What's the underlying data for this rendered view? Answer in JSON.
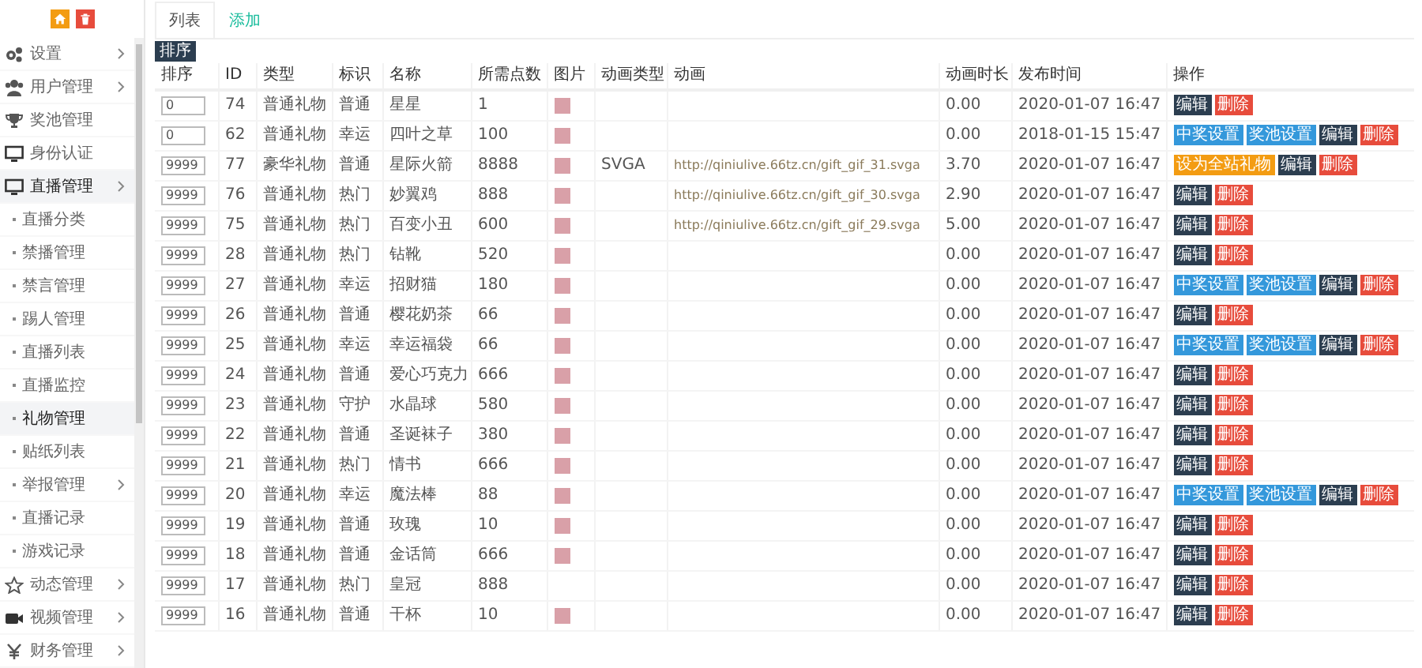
{
  "sidebar": {
    "items": [
      {
        "label": "设置",
        "submenu": true,
        "expanded": false
      },
      {
        "label": "用户管理",
        "submenu": true,
        "expanded": false
      },
      {
        "label": "奖池管理",
        "submenu": false,
        "expanded": false
      },
      {
        "label": "身份认证",
        "submenu": false,
        "expanded": false
      },
      {
        "label": "直播管理",
        "submenu": true,
        "expanded": true,
        "children": [
          {
            "label": "直播分类",
            "selected": false,
            "submenu": false
          },
          {
            "label": "禁播管理",
            "selected": false,
            "submenu": false
          },
          {
            "label": "禁言管理",
            "selected": false,
            "submenu": false
          },
          {
            "label": "踢人管理",
            "selected": false,
            "submenu": false
          },
          {
            "label": "直播列表",
            "selected": false,
            "submenu": false
          },
          {
            "label": "直播监控",
            "selected": false,
            "submenu": false
          },
          {
            "label": "礼物管理",
            "selected": true,
            "submenu": false
          },
          {
            "label": "贴纸列表",
            "selected": false,
            "submenu": false
          },
          {
            "label": "举报管理",
            "selected": false,
            "submenu": true
          },
          {
            "label": "直播记录",
            "selected": false,
            "submenu": false
          },
          {
            "label": "游戏记录",
            "selected": false,
            "submenu": false
          }
        ]
      },
      {
        "label": "动态管理",
        "submenu": true,
        "expanded": false
      },
      {
        "label": "视频管理",
        "submenu": true,
        "expanded": false
      },
      {
        "label": "财务管理",
        "submenu": true,
        "expanded": false
      }
    ]
  },
  "tabs": [
    {
      "label": "列表",
      "selected": true
    },
    {
      "label": "添加",
      "selected": false
    }
  ],
  "sort_button": "排序",
  "table": {
    "columns": [
      "排序",
      "ID",
      "类型",
      "标识",
      "名称",
      "所需点数",
      "图片",
      "动画类型",
      "动画",
      "动画时长",
      "发布时间",
      "操作"
    ],
    "rows": [
      {
        "sort": "0",
        "id": "74",
        "type": "普通礼物",
        "mark": "普通",
        "name": "星星",
        "points": "1",
        "has_image": true,
        "duration": "0.00",
        "time": "2020-01-07 16:47",
        "actions": [
          {
            "label": "编辑",
            "kind": "dark"
          },
          {
            "label": "删除",
            "kind": "red"
          }
        ]
      },
      {
        "sort": "0",
        "id": "62",
        "type": "普通礼物",
        "mark": "幸运",
        "name": "四叶之草",
        "points": "100",
        "has_image": true,
        "duration": "0.00",
        "time": "2018-01-15 15:47",
        "actions": [
          {
            "label": "中奖设置",
            "kind": "blue"
          },
          {
            "label": "奖池设置",
            "kind": "blue"
          },
          {
            "label": "编辑",
            "kind": "dark"
          },
          {
            "label": "删除",
            "kind": "red"
          }
        ]
      },
      {
        "sort": "9999",
        "id": "77",
        "type": "豪华礼物",
        "mark": "普通",
        "name": "星际火箭",
        "points": "8888",
        "has_image": true,
        "anim_type": "SVGA",
        "anim": "http://qiniulive.66tz.cn/gift_gif_31.svga",
        "duration": "3.70",
        "time": "2020-01-07 16:47",
        "actions": [
          {
            "label": "设为全站礼物",
            "kind": "orange"
          },
          {
            "label": "编辑",
            "kind": "dark"
          },
          {
            "label": "删除",
            "kind": "red"
          }
        ]
      },
      {
        "sort": "9999",
        "id": "76",
        "type": "普通礼物",
        "mark": "热门",
        "name": "妙翼鸡",
        "points": "888",
        "has_image": true,
        "anim": "http://qiniulive.66tz.cn/gift_gif_30.svga",
        "duration": "2.90",
        "time": "2020-01-07 16:47",
        "actions": [
          {
            "label": "编辑",
            "kind": "dark"
          },
          {
            "label": "删除",
            "kind": "red"
          }
        ]
      },
      {
        "sort": "9999",
        "id": "75",
        "type": "普通礼物",
        "mark": "热门",
        "name": "百变小丑",
        "points": "600",
        "has_image": true,
        "anim": "http://qiniulive.66tz.cn/gift_gif_29.svga",
        "duration": "5.00",
        "time": "2020-01-07 16:47",
        "actions": [
          {
            "label": "编辑",
            "kind": "dark"
          },
          {
            "label": "删除",
            "kind": "red"
          }
        ]
      },
      {
        "sort": "9999",
        "id": "28",
        "type": "普通礼物",
        "mark": "热门",
        "name": "钻靴",
        "points": "520",
        "has_image": true,
        "duration": "0.00",
        "time": "2020-01-07 16:47",
        "actions": [
          {
            "label": "编辑",
            "kind": "dark"
          },
          {
            "label": "删除",
            "kind": "red"
          }
        ]
      },
      {
        "sort": "9999",
        "id": "27",
        "type": "普通礼物",
        "mark": "幸运",
        "name": "招财猫",
        "points": "180",
        "has_image": true,
        "duration": "0.00",
        "time": "2020-01-07 16:47",
        "actions": [
          {
            "label": "中奖设置",
            "kind": "blue"
          },
          {
            "label": "奖池设置",
            "kind": "blue"
          },
          {
            "label": "编辑",
            "kind": "dark"
          },
          {
            "label": "删除",
            "kind": "red"
          }
        ]
      },
      {
        "sort": "9999",
        "id": "26",
        "type": "普通礼物",
        "mark": "普通",
        "name": "樱花奶茶",
        "points": "66",
        "has_image": true,
        "duration": "0.00",
        "time": "2020-01-07 16:47",
        "actions": [
          {
            "label": "编辑",
            "kind": "dark"
          },
          {
            "label": "删除",
            "kind": "red"
          }
        ]
      },
      {
        "sort": "9999",
        "id": "25",
        "type": "普通礼物",
        "mark": "幸运",
        "name": "幸运福袋",
        "points": "66",
        "has_image": true,
        "duration": "0.00",
        "time": "2020-01-07 16:47",
        "actions": [
          {
            "label": "中奖设置",
            "kind": "blue"
          },
          {
            "label": "奖池设置",
            "kind": "blue"
          },
          {
            "label": "编辑",
            "kind": "dark"
          },
          {
            "label": "删除",
            "kind": "red"
          }
        ]
      },
      {
        "sort": "9999",
        "id": "24",
        "type": "普通礼物",
        "mark": "普通",
        "name": "爱心巧克力",
        "points": "666",
        "has_image": true,
        "duration": "0.00",
        "time": "2020-01-07 16:47",
        "actions": [
          {
            "label": "编辑",
            "kind": "dark"
          },
          {
            "label": "删除",
            "kind": "red"
          }
        ]
      },
      {
        "sort": "9999",
        "id": "23",
        "type": "普通礼物",
        "mark": "守护",
        "name": "水晶球",
        "points": "580",
        "has_image": true,
        "duration": "0.00",
        "time": "2020-01-07 16:47",
        "actions": [
          {
            "label": "编辑",
            "kind": "dark"
          },
          {
            "label": "删除",
            "kind": "red"
          }
        ]
      },
      {
        "sort": "9999",
        "id": "22",
        "type": "普通礼物",
        "mark": "普通",
        "name": "圣诞袜子",
        "points": "380",
        "has_image": true,
        "duration": "0.00",
        "time": "2020-01-07 16:47",
        "actions": [
          {
            "label": "编辑",
            "kind": "dark"
          },
          {
            "label": "删除",
            "kind": "red"
          }
        ]
      },
      {
        "sort": "9999",
        "id": "21",
        "type": "普通礼物",
        "mark": "热门",
        "name": "情书",
        "points": "666",
        "has_image": true,
        "duration": "0.00",
        "time": "2020-01-07 16:47",
        "actions": [
          {
            "label": "编辑",
            "kind": "dark"
          },
          {
            "label": "删除",
            "kind": "red"
          }
        ]
      },
      {
        "sort": "9999",
        "id": "20",
        "type": "普通礼物",
        "mark": "幸运",
        "name": "魔法棒",
        "points": "88",
        "has_image": true,
        "duration": "0.00",
        "time": "2020-01-07 16:47",
        "actions": [
          {
            "label": "中奖设置",
            "kind": "blue"
          },
          {
            "label": "奖池设置",
            "kind": "blue"
          },
          {
            "label": "编辑",
            "kind": "dark"
          },
          {
            "label": "删除",
            "kind": "red"
          }
        ]
      },
      {
        "sort": "9999",
        "id": "19",
        "type": "普通礼物",
        "mark": "普通",
        "name": "玫瑰",
        "points": "10",
        "has_image": true,
        "duration": "0.00",
        "time": "2020-01-07 16:47",
        "actions": [
          {
            "label": "编辑",
            "kind": "dark"
          },
          {
            "label": "删除",
            "kind": "red"
          }
        ]
      },
      {
        "sort": "9999",
        "id": "18",
        "type": "普通礼物",
        "mark": "普通",
        "name": "金话筒",
        "points": "666",
        "has_image": true,
        "duration": "0.00",
        "time": "2020-01-07 16:47",
        "actions": [
          {
            "label": "编辑",
            "kind": "dark"
          },
          {
            "label": "删除",
            "kind": "red"
          }
        ]
      },
      {
        "sort": "9999",
        "id": "17",
        "type": "普通礼物",
        "mark": "热门",
        "name": "皇冠",
        "points": "888",
        "has_image": false,
        "duration": "0.00",
        "time": "2020-01-07 16:47",
        "actions": [
          {
            "label": "编辑",
            "kind": "dark"
          },
          {
            "label": "删除",
            "kind": "red"
          }
        ]
      },
      {
        "sort": "9999",
        "id": "16",
        "type": "普通礼物",
        "mark": "普通",
        "name": "干杯",
        "points": "10",
        "has_image": true,
        "duration": "0.00",
        "time": "2020-01-07 16:47",
        "actions": [
          {
            "label": "编辑",
            "kind": "dark"
          },
          {
            "label": "删除",
            "kind": "red"
          }
        ]
      }
    ]
  }
}
